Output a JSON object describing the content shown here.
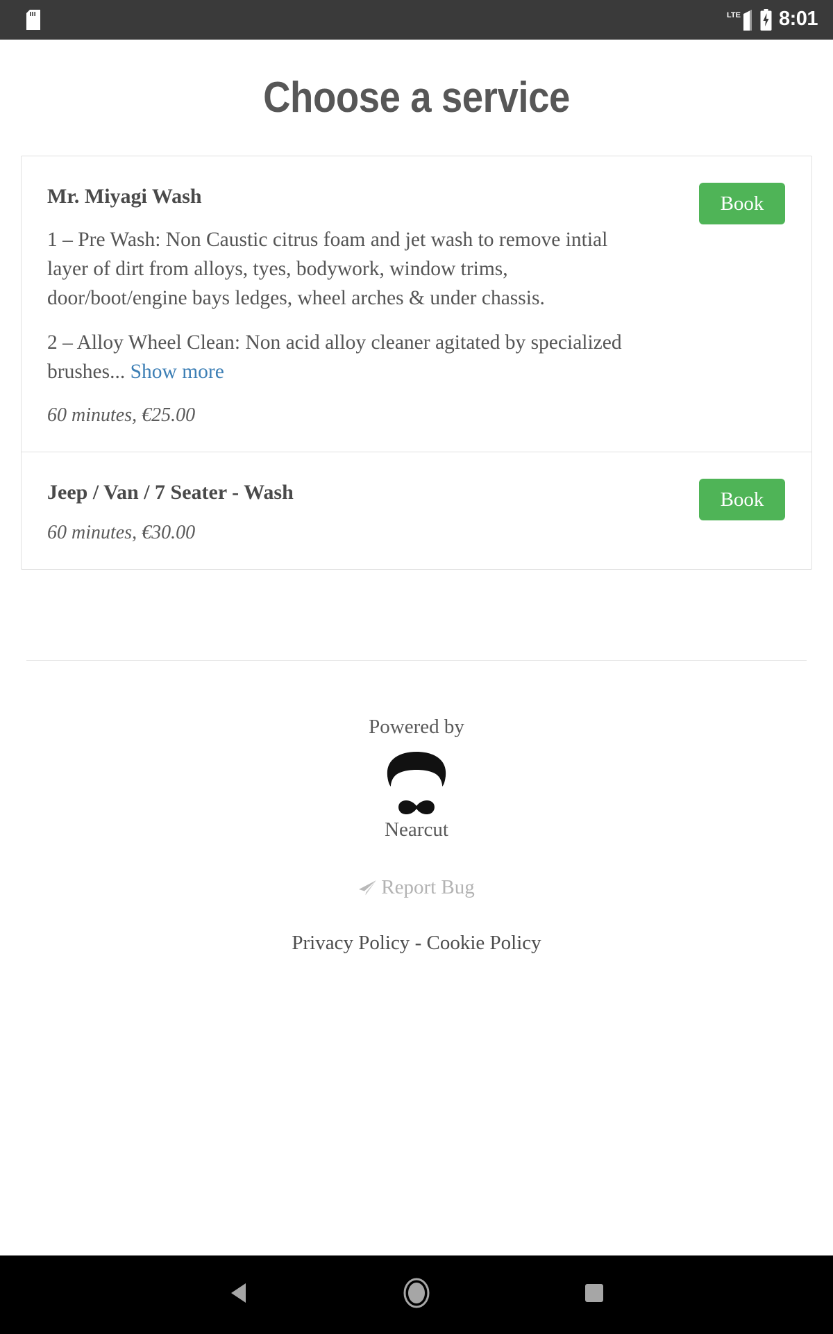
{
  "status_bar": {
    "time": "8:01",
    "network_label": "LTE",
    "icons": [
      "sd-card-icon",
      "signal-icon",
      "battery-charging-icon"
    ]
  },
  "header": {
    "title": "Choose a service"
  },
  "services": [
    {
      "name": "Mr. Miyagi Wash",
      "description_1": "1 – Pre Wash: Non Caustic citrus foam and jet wash to remove intial layer of dirt from  alloys, tyes, bodywork, window trims, door/boot/engine bays ledges, wheel arches & under chassis.",
      "description_2": "2 – Alloy Wheel Clean: Non acid alloy cleaner agitated by specialized brushes... ",
      "show_more_label": "Show more",
      "price": "60 minutes, €25.00",
      "book_label": "Book"
    },
    {
      "name": "Jeep / Van / 7 Seater - Wash",
      "price": "60 minutes, €30.00",
      "book_label": "Book"
    }
  ],
  "footer": {
    "powered_by": "Powered by",
    "brand": "Nearcut",
    "report_bug": "Report Bug",
    "privacy_policy": "Privacy Policy",
    "separator": " - ",
    "cookie_policy": "Cookie Policy"
  },
  "nav_bar": {
    "back": "back-triangle-icon",
    "home": "home-circle-icon",
    "recents": "recents-square-icon"
  },
  "colors": {
    "accent_green": "#4fb457",
    "link_blue": "#3d7fb5",
    "status_bar_bg": "#3a3a3a",
    "nav_bar_bg": "#000000",
    "text_dark": "#4a4a4a",
    "text_muted": "#b3b3b3"
  }
}
